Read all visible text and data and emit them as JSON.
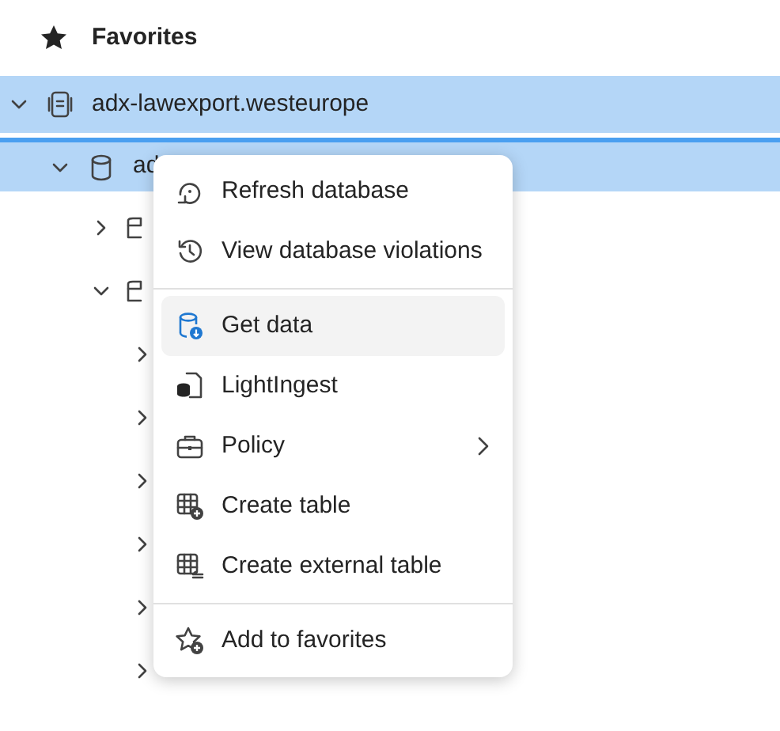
{
  "favorites": {
    "label": "Favorites"
  },
  "tree": [
    {
      "label": "adx-lawexport.westeurope",
      "expanded": true,
      "selected": true,
      "children": [
        {
          "label": "ad",
          "expanded": true,
          "selected": true,
          "children": [
            {
              "expanded": false,
              "selected": false
            },
            {
              "expanded": true,
              "selected": false,
              "children": [
                {
                  "expanded": false,
                  "selected": false
                },
                {
                  "expanded": false,
                  "selected": false
                },
                {
                  "expanded": false,
                  "selected": false
                },
                {
                  "expanded": false,
                  "selected": false
                },
                {
                  "expanded": false,
                  "selected": false
                },
                {
                  "expanded": false,
                  "selected": false
                }
              ]
            }
          ]
        }
      ]
    }
  ],
  "context_menu": {
    "groups": [
      [
        {
          "label": "Refresh database",
          "highlighted": false,
          "has_submenu": false
        },
        {
          "label": "View database violations",
          "highlighted": false,
          "has_submenu": false
        }
      ],
      [
        {
          "label": "Get data",
          "highlighted": true,
          "has_submenu": false
        },
        {
          "label": "LightIngest",
          "highlighted": false,
          "has_submenu": false
        },
        {
          "label": "Policy",
          "highlighted": false,
          "has_submenu": true
        },
        {
          "label": "Create table",
          "highlighted": false,
          "has_submenu": false
        },
        {
          "label": "Create external table",
          "highlighted": false,
          "has_submenu": false
        }
      ],
      [
        {
          "label": "Add to favorites",
          "highlighted": false,
          "has_submenu": false
        }
      ]
    ]
  }
}
